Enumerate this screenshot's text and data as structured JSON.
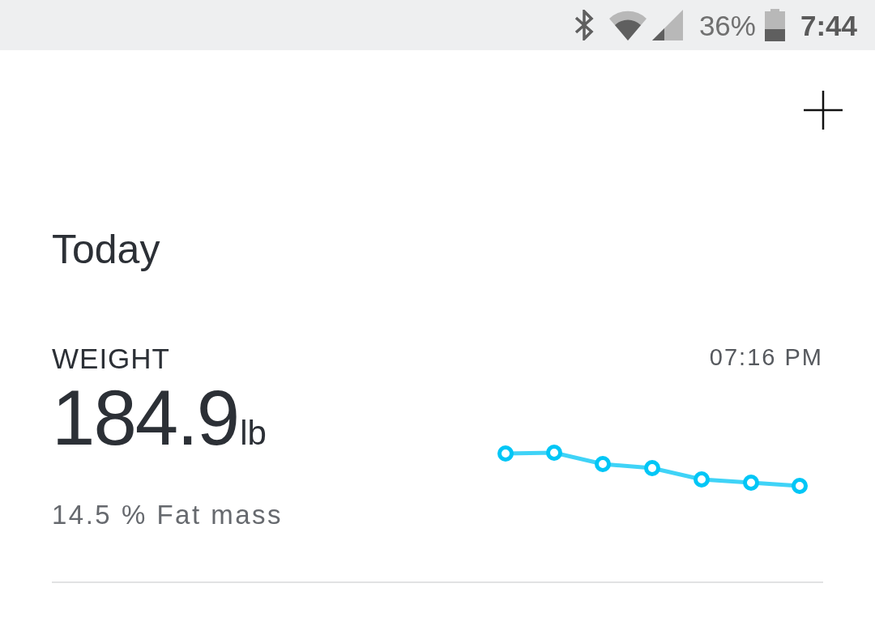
{
  "status_bar": {
    "battery_percent": "36%",
    "time": "7:44"
  },
  "header": {
    "title": "Today"
  },
  "weight_card": {
    "label": "WEIGHT",
    "value": "184.9",
    "unit": "lb",
    "fat_mass": "14.5 % Fat mass",
    "time": "07:16 PM"
  }
}
